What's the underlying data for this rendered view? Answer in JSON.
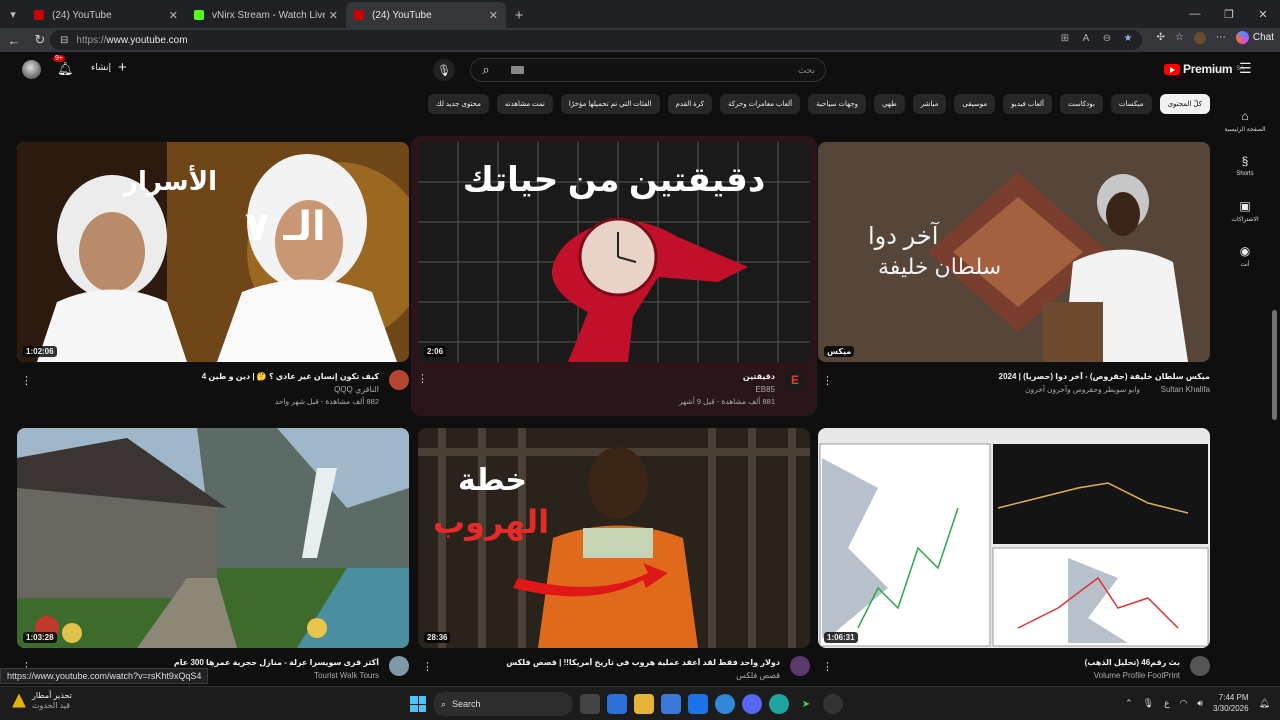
{
  "browser": {
    "tabs": [
      {
        "title": "(24) YouTube",
        "active": false,
        "fav": "#cc0000"
      },
      {
        "title": "vNirx Stream - Watch Live on Kick",
        "active": false,
        "fav": "#53fc18"
      },
      {
        "title": "(24) YouTube",
        "active": true,
        "fav": "#cc0000"
      }
    ],
    "url_prefix": "https://",
    "url_host": "www.youtube.com",
    "chat_label": "Chat"
  },
  "yt": {
    "notif_count": "9+",
    "create_label": "إنشاء",
    "search_placeholder": "بحث",
    "premium_label": "Premium",
    "region": "SA",
    "chips": [
      "كلّ المحتوى",
      "ميكسات",
      "بودكاست",
      "ألعاب فيديو",
      "موسيقى",
      "مباشر",
      "طهي",
      "وجهات سياحية",
      "ألعاب مغامرات وحركة",
      "كرة القدم",
      "الفئات التي تم تحميلها مؤخرًا",
      "تمت مشاهدته",
      "محتوى جديد لك"
    ],
    "rail": [
      {
        "label": "الصفحة الرئيسية",
        "icon": "home-icon",
        "glyph": "⌂"
      },
      {
        "label": "Shorts",
        "icon": "shorts-icon",
        "glyph": "§"
      },
      {
        "label": "الاشتراكات",
        "icon": "subscriptions-icon",
        "glyph": "▣"
      },
      {
        "label": "أنت",
        "icon": "you-icon",
        "glyph": "◉"
      }
    ],
    "videos": [
      {
        "title": "كيف تكون إنسان غير عادي ؟ 🤔 | دين و طين 4",
        "channel": "الناقري QQQ",
        "stats": "882 ألف مشاهدة - قبل شهر واحد",
        "duration": "1:02:06"
      },
      {
        "title": "دقيقتين",
        "channel": "EB85",
        "stats": "881 ألف مشاهدة - قبل 9 أشهر",
        "duration": "2:06",
        "thumb_text": "دقيقتين من حياتك"
      },
      {
        "title": "ميكس سلطان خليفة (حقروص) - آخر دوا (حصرياً) | 2024",
        "channel": "Sultan Khalifa",
        "stats": "وابو سويطر وحقروص وآخرون آخرون",
        "duration": "ميكس",
        "thumb_text_1": "آخر دوا",
        "thumb_text_2": "سلطان خليفة"
      },
      {
        "title": "أكثر قرى سويسرا عزلة - منازل حجرية عمرها 300 عام",
        "channel": "Tourist Walk Tours",
        "stats": "",
        "duration": "1:03:28"
      },
      {
        "title": "دولار واحد فقط لقد أعقد عملية هروب في تاريخ أمريكا!! | قصص فلكس",
        "channel": "قصص فلكس",
        "stats": "",
        "duration": "28:36",
        "thumb_text_1": "خطة",
        "thumb_text_2": "الهروب"
      },
      {
        "title": "بث رقم46 (تحليل الذهب)",
        "channel": "Volume Profile FootPrint",
        "stats": "",
        "duration": "1:06:31"
      }
    ]
  },
  "status_url": "https://www.youtube.com/watch?v=rsKht9xQqS4",
  "taskbar": {
    "weather_line1": "تحذير أمطار",
    "weather_line2": "قيد الحدوث",
    "search_label": "Search",
    "lang": "ع",
    "time": "7:44 PM",
    "date": "3/30/2026"
  }
}
